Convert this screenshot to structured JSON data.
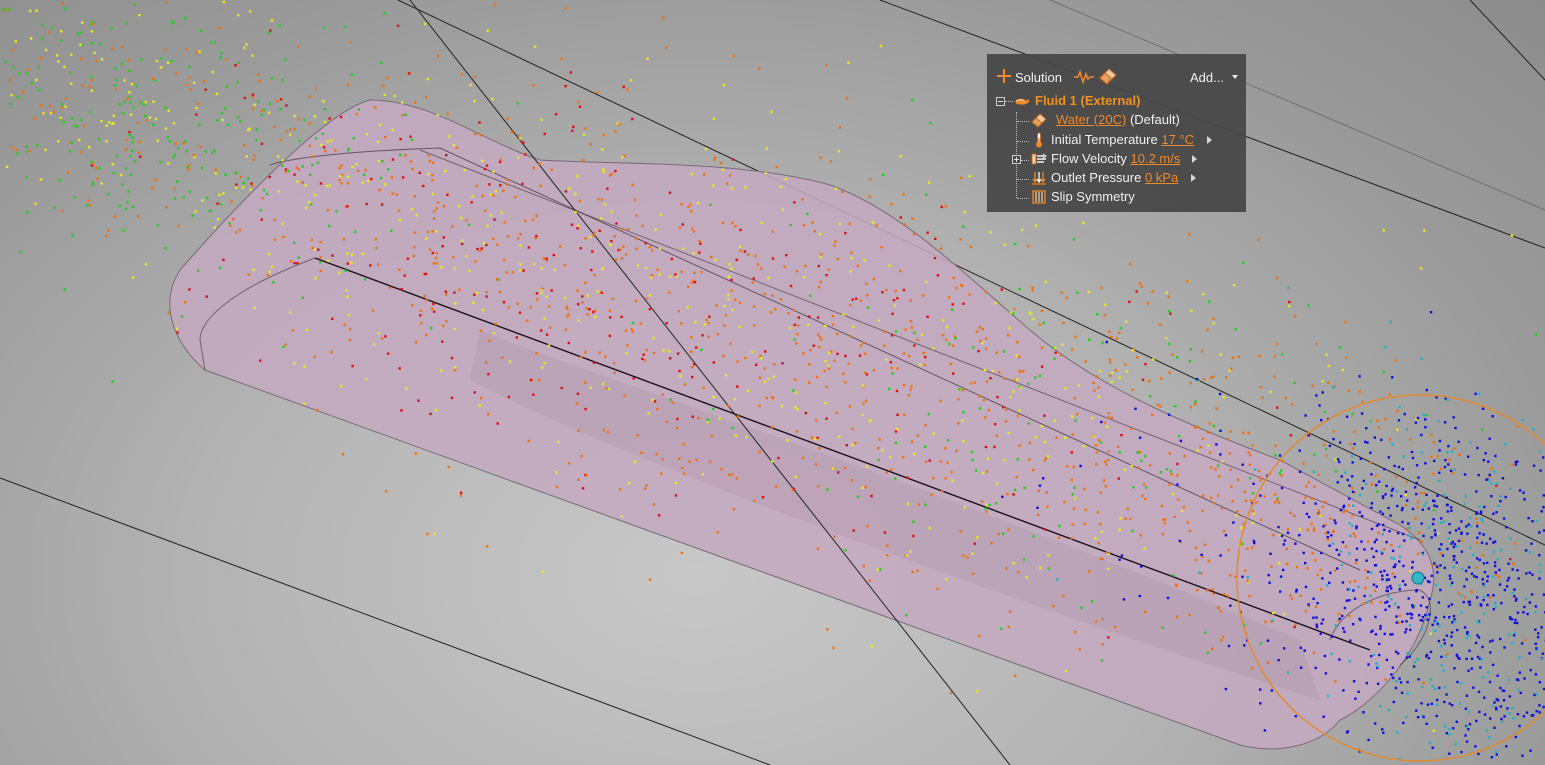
{
  "panel": {
    "toolbar": {
      "solution_label": "Solution",
      "add_label": "Add...",
      "icons": [
        "plus-icon",
        "waveform-icon",
        "eraser-icon",
        "dropdown-caret-icon"
      ]
    },
    "tree": {
      "fluid": {
        "label": "Fluid 1",
        "qualifier": "(External)"
      },
      "material": {
        "value": "Water (20C)",
        "suffix": "(Default)"
      },
      "initial_temperature": {
        "label": "Initial Temperature",
        "value": "17 °C"
      },
      "flow_velocity": {
        "label": "Flow Velocity",
        "value": "10.2 m/s"
      },
      "outlet_pressure": {
        "label": "Outlet Pressure",
        "value": "0 kPa"
      },
      "slip_symmetry": {
        "label": "Slip Symmetry"
      }
    }
  },
  "colors": {
    "accent_orange": "#f0892a",
    "panel_bg": "#484848",
    "body_fill": "#c4aabf",
    "particle_green": "#22cc22",
    "particle_yellow": "#e8e820",
    "particle_orange": "#f07010",
    "particle_red": "#dd1010",
    "particle_blue": "#1010dd",
    "particle_cyan": "#20b0c8"
  }
}
